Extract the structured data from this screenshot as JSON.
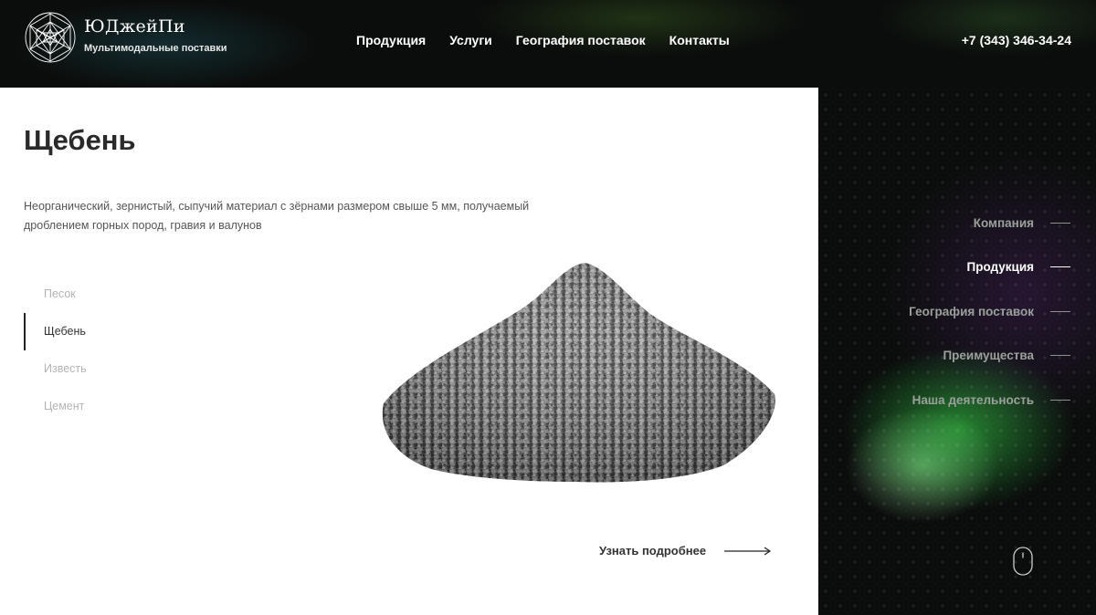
{
  "brand": {
    "name": "ЮДжейПи",
    "tagline": "Мультимодальные поставки",
    "logo_icon": "geometric-sphere-logo"
  },
  "topnav": {
    "items": [
      {
        "label": "Продукция"
      },
      {
        "label": "Услуги"
      },
      {
        "label": "География поставок"
      },
      {
        "label": "Контакты"
      }
    ]
  },
  "contact": {
    "phone": "+7 (343) 346-34-24"
  },
  "product": {
    "title": "Щебень",
    "description": "Неорганический, зернистый, сыпучий материал с зёрнами размером свыше 5 мм, получаемый дроблением горных пород, гравия и валунов",
    "more_label": "Узнать подробнее",
    "image_icon": "gravel-pile-image"
  },
  "categories": {
    "items": [
      {
        "label": "Песок",
        "active": false
      },
      {
        "label": "Щебень",
        "active": true
      },
      {
        "label": "Известь",
        "active": false
      },
      {
        "label": "Цемент",
        "active": false
      }
    ]
  },
  "sidenav": {
    "items": [
      {
        "label": "Компания",
        "active": false
      },
      {
        "label": "Продукция",
        "active": true
      },
      {
        "label": "География поставок",
        "active": false
      },
      {
        "label": "Преимущества",
        "active": false
      },
      {
        "label": "Наша деятельность",
        "active": false
      }
    ]
  },
  "colors": {
    "background": "#0b0d0c",
    "panel": "#ffffff",
    "accent_green": "#3ce650",
    "text_dark": "#2a2a2a",
    "text_muted": "#b4b4b4"
  },
  "icons": [
    "geometric-sphere-logo",
    "arrow-right-icon",
    "mouse-scroll-icon"
  ]
}
